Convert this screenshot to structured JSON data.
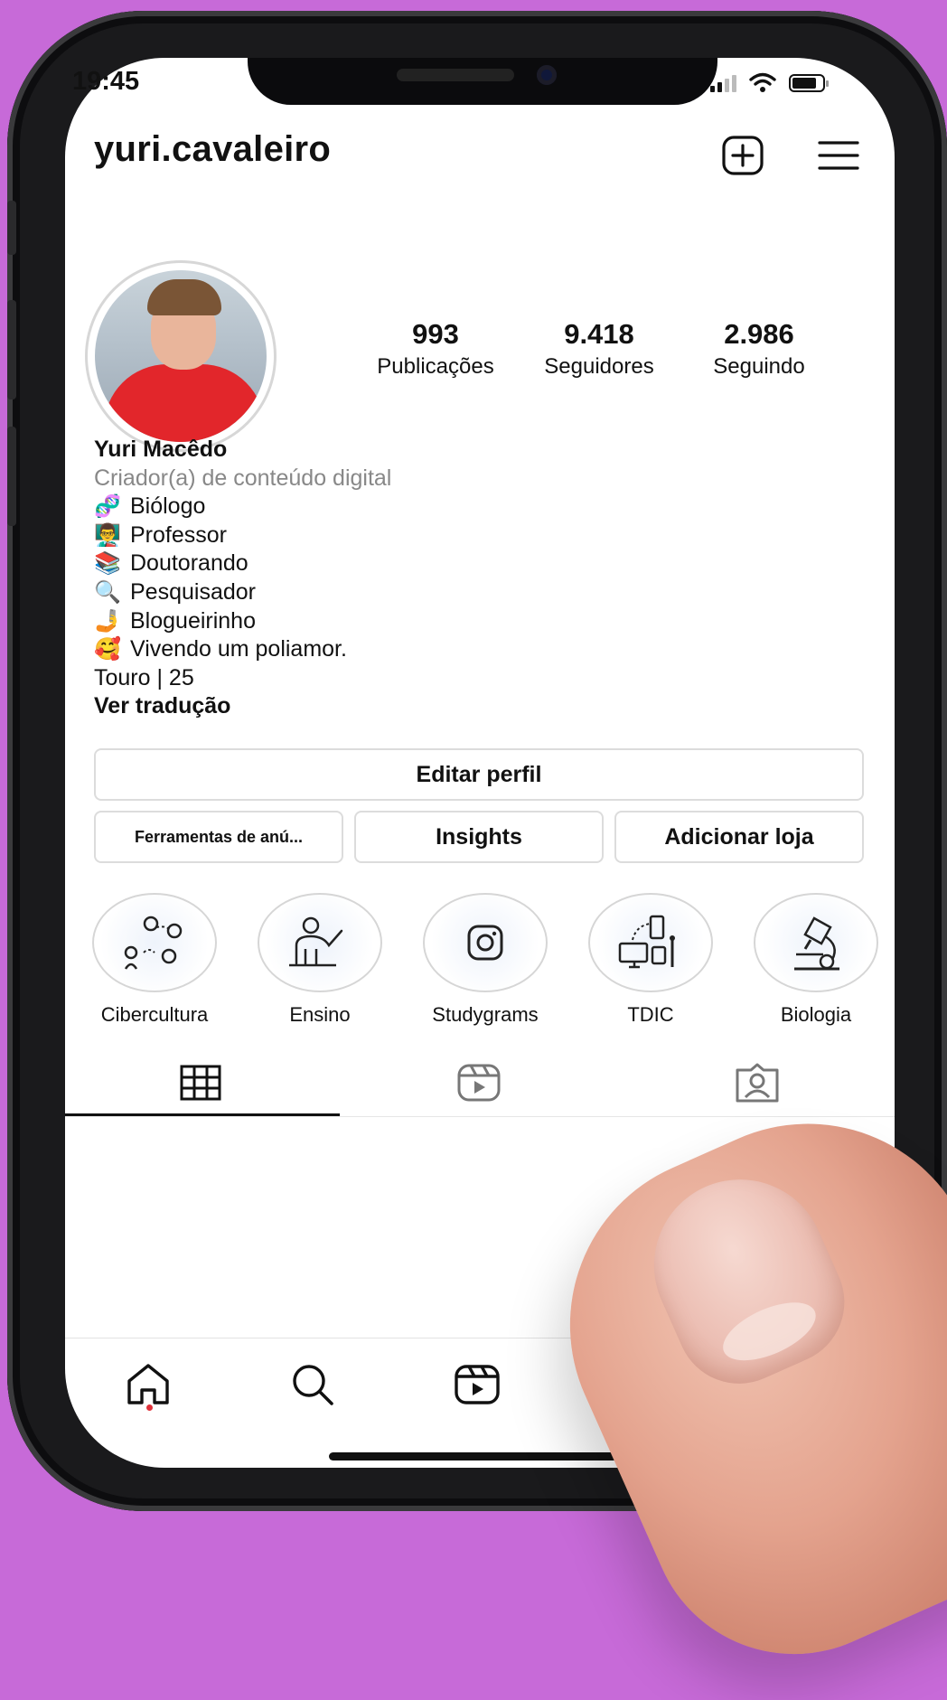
{
  "status": {
    "time": "19:45"
  },
  "profile": {
    "username": "yuri.cavaleiro",
    "stats": [
      {
        "value": "993",
        "label": "Publicações"
      },
      {
        "value": "9.418",
        "label": "Seguidores"
      },
      {
        "value": "2.986",
        "label": "Seguindo"
      }
    ],
    "name": "Yuri Macêdo",
    "category": "Criador(a) de conteúdo digital",
    "bio_lines": [
      {
        "emoji": "🧬",
        "text": "Biólogo"
      },
      {
        "emoji": "👨‍🏫",
        "text": "Professor"
      },
      {
        "emoji": "📚",
        "text": "Doutorando"
      },
      {
        "emoji": "🔍",
        "text": "Pesquisador"
      },
      {
        "emoji": "🤳",
        "text": "Blogueirinho"
      },
      {
        "emoji": "🥰",
        "text": "Vivendo um poliamor."
      }
    ],
    "extra_line": "Touro | 25",
    "translate_link": "Ver tradução"
  },
  "buttons": {
    "edit_profile": "Editar perfil",
    "ad_tools": "Ferramentas de anú...",
    "insights": "Insights",
    "add_shop": "Adicionar loja"
  },
  "highlights": [
    {
      "label": "Cibercultura",
      "icon": "network-people-icon"
    },
    {
      "label": "Ensino",
      "icon": "teacher-board-icon"
    },
    {
      "label": "Studygrams",
      "icon": "instagram-icon"
    },
    {
      "label": "TDIC",
      "icon": "devices-icon"
    },
    {
      "label": "Biologia",
      "icon": "microscope-icon"
    }
  ],
  "colors": {
    "background": "#c76ad8",
    "text": "#111111",
    "muted": "#888888",
    "notification_dot": "#e0313a"
  }
}
